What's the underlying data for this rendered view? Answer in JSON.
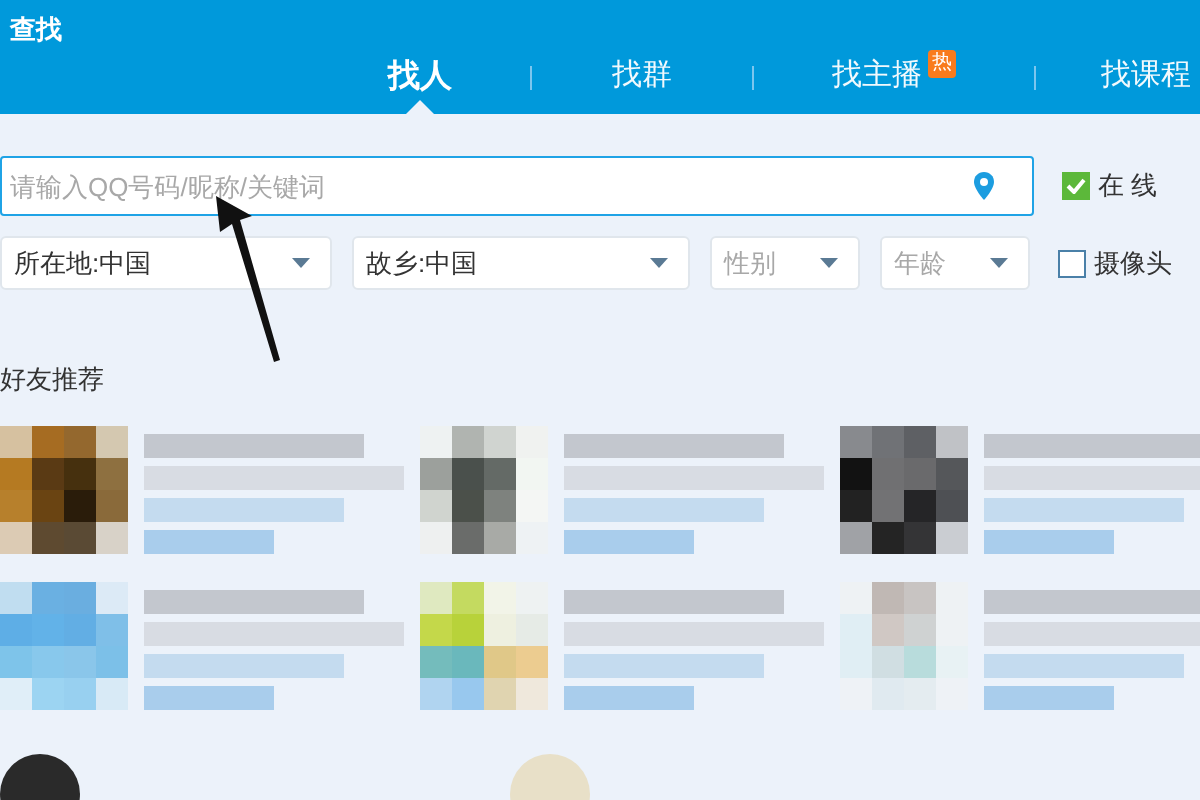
{
  "window": {
    "title": "查找"
  },
  "tabs": [
    {
      "label": "找人",
      "selected": true
    },
    {
      "label": "找群",
      "selected": false
    },
    {
      "label": "找主播",
      "selected": false,
      "badge": "热"
    },
    {
      "label": "找课程",
      "selected": false
    }
  ],
  "search": {
    "placeholder": "请输入QQ号码/昵称/关键词"
  },
  "filters": [
    {
      "kind": "value",
      "text": "所在地:中国"
    },
    {
      "kind": "value",
      "text": "故乡:中国"
    },
    {
      "kind": "placeholder",
      "text": "性别"
    },
    {
      "kind": "placeholder",
      "text": "年龄"
    }
  ],
  "options": [
    {
      "label": "在 线",
      "checked": true
    },
    {
      "label": "摄像头",
      "checked": false
    }
  ],
  "section_title": "好友推荐"
}
